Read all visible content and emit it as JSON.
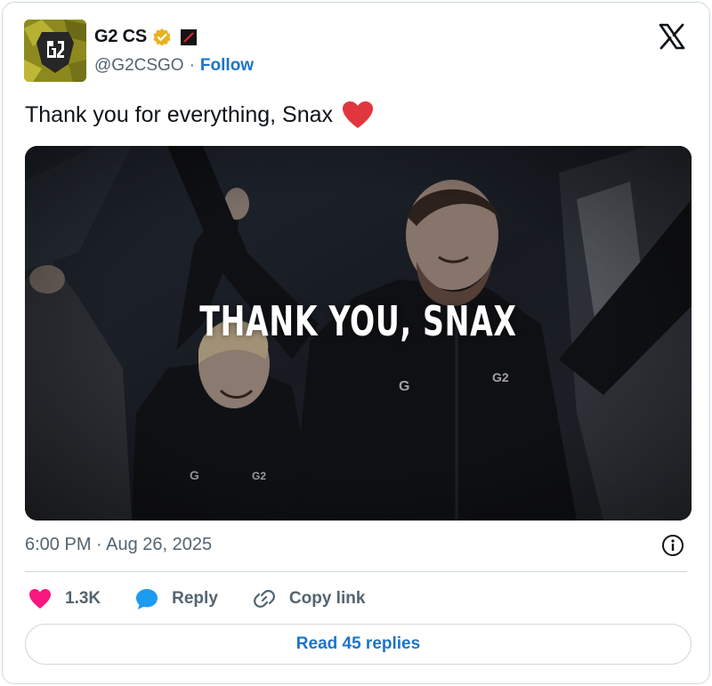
{
  "author": {
    "name": "G2 CS",
    "handle": "@G2CSGO",
    "separator": "·",
    "follow_label": "Follow",
    "verified_color": "#e8b21f"
  },
  "tweet": {
    "text": "Thank you for everything, Snax",
    "emoji": "heart-emoji",
    "media_caption": "THANK YOU, SNAX",
    "timestamp": "6:00 PM · Aug 26, 2025"
  },
  "actions": {
    "like_count": "1.3K",
    "reply_label": "Reply",
    "copy_link_label": "Copy link"
  },
  "read_replies_label": "Read 45 replies",
  "colors": {
    "link": "#1d74c8",
    "heart": "#f91880",
    "reply_blue": "#1d9bf0",
    "secondary_text": "#536471"
  }
}
